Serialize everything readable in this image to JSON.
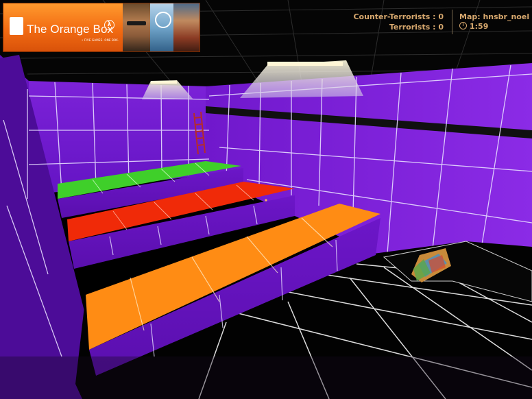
{
  "banner": {
    "title": "The Orange Box",
    "tagline": "• FIVE GAMES. ONE BOX."
  },
  "hud": {
    "ct_label": "Counter-Terrorists : 0",
    "t_label": "Terrorists : 0",
    "map_label": "Map: hnsbr_noel",
    "timer": "1:59"
  },
  "colors": {
    "hud_text": "#d7a86e",
    "wall_purple": "#6b12c8",
    "platform_green": "#3fcf2a",
    "platform_red": "#f02a08",
    "platform_orange": "#ff8c14"
  }
}
